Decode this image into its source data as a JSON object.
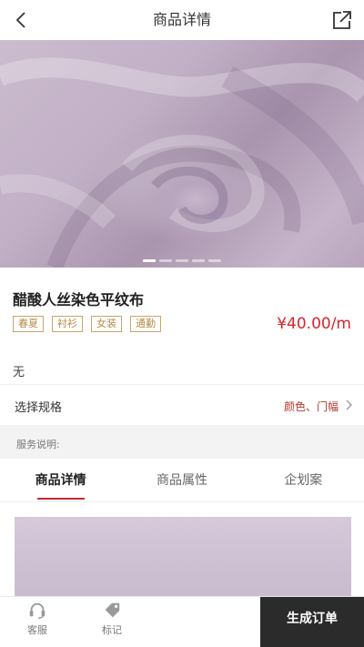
{
  "header": {
    "title": "商品详情",
    "back_icon": "chevron-left-icon",
    "share_icon": "share-icon"
  },
  "carousel": {
    "image": "lavender fabric",
    "slide_count": 5,
    "active_index": 0
  },
  "product": {
    "name": "醋酸人丝染色平纹布",
    "tags": [
      "春夏",
      "衬衫",
      "女装",
      "通勤"
    ],
    "price": "¥40.00/m",
    "description": "无"
  },
  "spec": {
    "label": "选择规格",
    "value": "颜色、门幅"
  },
  "service": {
    "label": "服务说明:"
  },
  "tabs": [
    {
      "label": "商品详情",
      "active": true
    },
    {
      "label": "商品属性",
      "active": false
    },
    {
      "label": "企划案",
      "active": false
    }
  ],
  "bottom_bar": {
    "service_label": "客服",
    "service_icon": "headset-icon",
    "bookmark_label": "标记",
    "bookmark_icon": "tag-icon",
    "order_label": "生成订单"
  },
  "colors": {
    "accent": "#d9252b",
    "tag": "#b48a47",
    "order_button": "#2b2b2b"
  }
}
